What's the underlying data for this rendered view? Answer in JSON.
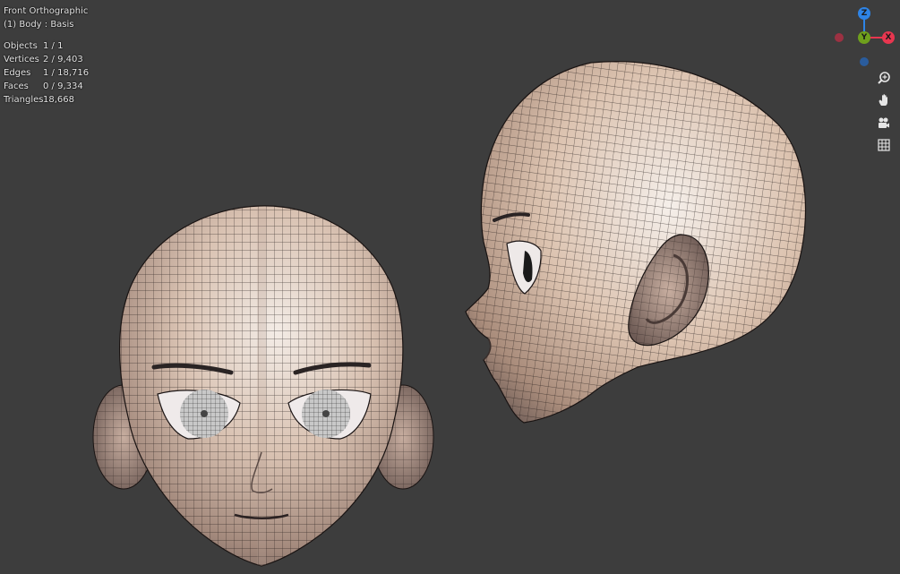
{
  "viewport": {
    "view_name": "Front Orthographic",
    "object_name": "(1) Body : Basis",
    "stats": [
      {
        "label": "Objects",
        "value": "1 / 1"
      },
      {
        "label": "Vertices",
        "value": "2 / 9,403"
      },
      {
        "label": "Edges",
        "value": "1 / 18,716"
      },
      {
        "label": "Faces",
        "value": "0 / 9,334"
      },
      {
        "label": "Triangles",
        "value": "18,668"
      }
    ],
    "background_color": "#3d3d3d"
  },
  "gizmo": {
    "z_label": "Z",
    "y_label": "Y",
    "x_label": "X",
    "colors": {
      "x": "#e8364f",
      "y": "#6fa01d",
      "z": "#2e84e6"
    }
  },
  "nav_tools": [
    {
      "name": "zoom-icon",
      "glyph": "⊕"
    },
    {
      "name": "pan-hand-icon",
      "glyph": "✋"
    },
    {
      "name": "camera-icon",
      "glyph": "🎥"
    },
    {
      "name": "grid-icon",
      "glyph": "▦"
    }
  ]
}
